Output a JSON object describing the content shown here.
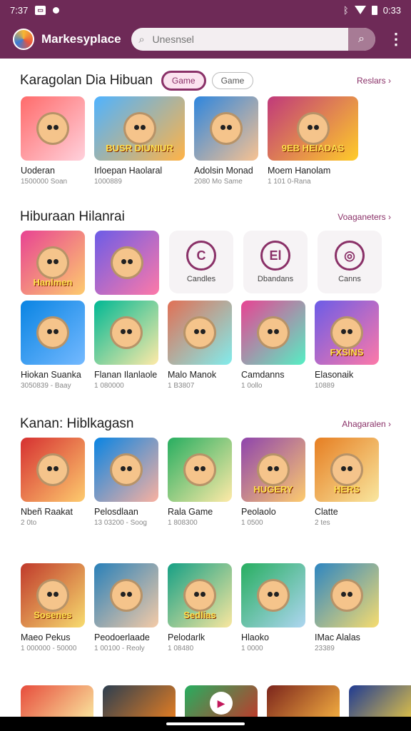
{
  "status_bar": {
    "time": "7:37",
    "right_text": "0:33"
  },
  "app": {
    "title": "Markesyplace"
  },
  "search": {
    "placeholder": "Unesnsel"
  },
  "sections": {
    "s1": {
      "title": "Karagolan Dia Hibuan",
      "chip_active": "Game",
      "chip_plain": "Game",
      "link": "Reslars ›",
      "items": [
        {
          "title": "Uoderan",
          "sub": "1500000 Soan",
          "color1": "#ff6b6b",
          "color2": "#ffd1dc",
          "banner": ""
        },
        {
          "title": "Irloepan Haolaral",
          "sub": "1000889",
          "color1": "#4fb3ff",
          "color2": "#ffb347",
          "banner": "BUSR DIUNIUR"
        },
        {
          "title": "Adolsin Monad",
          "sub": "2080 Mo Same",
          "color1": "#2e86de",
          "color2": "#f8c291",
          "banner": ""
        },
        {
          "title": "Moem Hanolam",
          "sub": "1 101 0-Rana",
          "color1": "#c0397b",
          "color2": "#ffcc29",
          "banner": "9EB HEIADAS"
        }
      ]
    },
    "s2": {
      "title": "Hiburaan Hilanrai",
      "link": "Voaganeters ›",
      "cats": [
        {
          "title": "",
          "color1": "#e84393",
          "color2": "#fdcb6e",
          "banner": "Hanlmen",
          "kind": "thumb"
        },
        {
          "title": "",
          "color1": "#6c5ce7",
          "color2": "#fd79a8",
          "banner": "",
          "kind": "thumb"
        },
        {
          "title": "Candles",
          "glyph": "C",
          "kind": "cat"
        },
        {
          "title": "Dbandans",
          "glyph": "El",
          "kind": "cat"
        },
        {
          "title": "Canns",
          "glyph": "◎",
          "kind": "cat"
        }
      ],
      "items": [
        {
          "title": "Hiokan Suanka",
          "sub": "3050839 - Baay",
          "color1": "#0984e3",
          "color2": "#74b9ff",
          "banner": ""
        },
        {
          "title": "Flanan Ilanlaole",
          "sub": "1 080000",
          "color1": "#00b894",
          "color2": "#ffeaa7",
          "banner": ""
        },
        {
          "title": "Malo Manok",
          "sub": "1 B3807",
          "color1": "#e17055",
          "color2": "#81ecec",
          "banner": ""
        },
        {
          "title": "Camdanns",
          "sub": "1 0ollo",
          "color1": "#e84393",
          "color2": "#55efc4",
          "banner": ""
        },
        {
          "title": "Elasonaik",
          "sub": "10889",
          "color1": "#6c5ce7",
          "color2": "#fd79a8",
          "banner": "FXSINS"
        }
      ]
    },
    "s3": {
      "title": "Kanan: Hiblkagasn",
      "link": "Ahagaralen ›",
      "items": [
        {
          "title": "Nbeñ Raakat",
          "sub": "2 0to",
          "color1": "#d63031",
          "color2": "#fdcb6e",
          "banner": ""
        },
        {
          "title": "Pelosdlaan",
          "sub": "13 03200 - Soog",
          "color1": "#0984e3",
          "color2": "#fab1a0",
          "banner": ""
        },
        {
          "title": "Rala Game",
          "sub": "1 808300",
          "color1": "#27ae60",
          "color2": "#ffeaa7",
          "banner": ""
        },
        {
          "title": "Peolaolo",
          "sub": "1 0500",
          "color1": "#8e44ad",
          "color2": "#fdcb6e",
          "banner": "HUGERY"
        },
        {
          "title": "Clatte",
          "sub": "2 tes",
          "color1": "#e67e22",
          "color2": "#f9e79f",
          "banner": "HERS"
        }
      ]
    },
    "s4": {
      "items": [
        {
          "title": "Maeo Pekus",
          "sub": "1 000000 - 50000",
          "color1": "#c0392b",
          "color2": "#f7dc6f",
          "banner": "Sosenes"
        },
        {
          "title": "Peodoerlaade",
          "sub": "1 00100 - Reoly",
          "color1": "#2980b9",
          "color2": "#f5cba7",
          "banner": ""
        },
        {
          "title": "Pelodarlk",
          "sub": "1 08480",
          "color1": "#16a085",
          "color2": "#f9e79f",
          "banner": "Sedlias"
        },
        {
          "title": "Hlaoko",
          "sub": "1 0000",
          "color1": "#27ae60",
          "color2": "#aed6f1",
          "banner": ""
        },
        {
          "title": "IMac Alalas",
          "sub": "23389",
          "color1": "#2e86c1",
          "color2": "#f7dc6f",
          "banner": ""
        }
      ]
    },
    "s5": {
      "items": [
        {
          "color1": "#e74c3c",
          "color2": "#f9e79f"
        },
        {
          "color1": "#2c3e50",
          "color2": "#e67e22"
        },
        {
          "color1": "#27ae60",
          "color2": "#c0392b"
        },
        {
          "color1": "#7b241c",
          "color2": "#f5b041"
        },
        {
          "color1": "#1f3a93",
          "color2": "#f4d03f"
        }
      ]
    }
  }
}
